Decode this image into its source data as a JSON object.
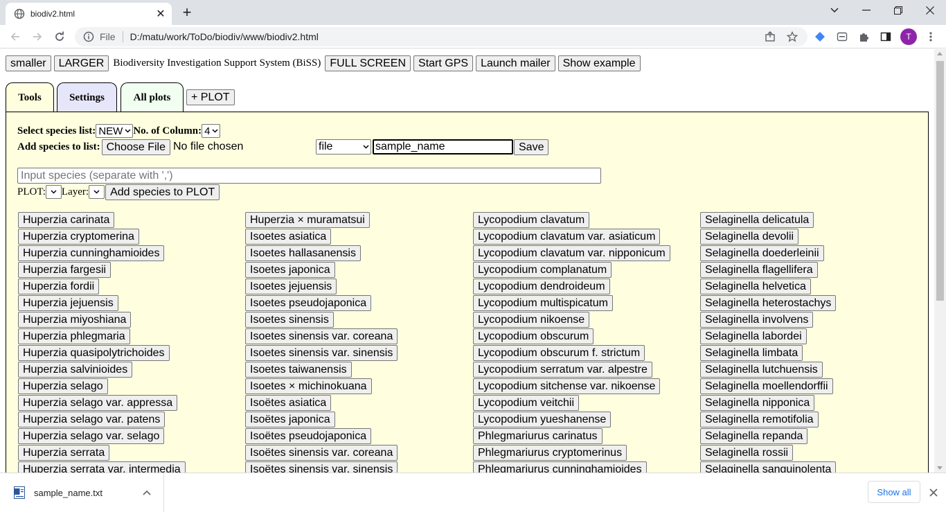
{
  "browser": {
    "tab_title": "biodiv2.html",
    "new_tab": "+",
    "scheme": "File",
    "url": "D:/matu/work/ToDo/biodiv/www/biodiv2.html",
    "avatar_letter": "T",
    "tab_close": "✕"
  },
  "topbar": {
    "smaller": "smaller",
    "larger": "LARGER",
    "title": "Biodiversity Investigation Support System (BiSS)",
    "fullscreen": "FULL SCREEN",
    "gps": "Start GPS",
    "mailer": "Launch mailer",
    "example": "Show example"
  },
  "tabs": {
    "tools": "Tools",
    "settings": "Settings",
    "allplots": "All plots",
    "addplot": "+ PLOT"
  },
  "tools": {
    "select_list_label": "Select species list:",
    "list_value": "NEW",
    "columns_label": "No. of Column:",
    "columns_value": "4",
    "add_label": "Add species to list:",
    "choose_file": "Choose File",
    "no_file": "No file chosen",
    "format_value": "file",
    "filename_value": "sample_name",
    "save": "Save",
    "species_placeholder": "Input species (separate with ',')",
    "plot_label": "PLOT:",
    "layer_label": "Layer:",
    "add_to_plot": "Add species to PLOT"
  },
  "species_columns": [
    [
      "Huperzia carinata",
      "Huperzia cryptomerina",
      "Huperzia cunninghamioides",
      "Huperzia fargesii",
      "Huperzia fordii",
      "Huperzia jejuensis",
      "Huperzia miyoshiana",
      "Huperzia phlegmaria",
      "Huperzia quasipolytrichoides",
      "Huperzia salvinioides",
      "Huperzia selago",
      "Huperzia selago var. appressa",
      "Huperzia selago var. patens",
      "Huperzia selago var. selago",
      "Huperzia serrata",
      "Huperzia serrata var. intermedia"
    ],
    [
      "Huperzia × muramatsui",
      "Isoetes asiatica",
      "Isoetes hallasanensis",
      "Isoetes japonica",
      "Isoetes jejuensis",
      "Isoetes pseudojaponica",
      "Isoetes sinensis",
      "Isoetes sinensis var. coreana",
      "Isoetes sinensis var. sinensis",
      "Isoetes taiwanensis",
      "Isoetes × michinokuana",
      "Isoëtes asiatica",
      "Isoëtes japonica",
      "Isoëtes pseudojaponica",
      "Isoëtes sinensis var. coreana",
      "Isoëtes sinensis var. sinensis"
    ],
    [
      "Lycopodium clavatum",
      "Lycopodium clavatum var. asiaticum",
      "Lycopodium clavatum var. nipponicum",
      "Lycopodium complanatum",
      "Lycopodium dendroideum",
      "Lycopodium multispicatum",
      "Lycopodium nikoense",
      "Lycopodium obscurum",
      "Lycopodium obscurum f. strictum",
      "Lycopodium serratum var. alpestre",
      "Lycopodium sitchense var. nikoense",
      "Lycopodium veitchii",
      "Lycopodium yueshanense",
      "Phlegmariurus carinatus",
      "Phlegmariurus cryptomerinus",
      "Phlegmariurus cunninghamioides"
    ],
    [
      "Selaginella delicatula",
      "Selaginella devolii",
      "Selaginella doederleinii",
      "Selaginella flagellifera",
      "Selaginella helvetica",
      "Selaginella heterostachys",
      "Selaginella involvens",
      "Selaginella labordei",
      "Selaginella limbata",
      "Selaginella lutchuensis",
      "Selaginella moellendorffii",
      "Selaginella nipponica",
      "Selaginella remotifolia",
      "Selaginella repanda",
      "Selaginella rossii",
      "Selaginella sanguinolenta"
    ]
  ],
  "downloads": {
    "file_name": "sample_name.txt",
    "show_all": "Show all"
  },
  "colors": {
    "panel_bg": "#ffffe0",
    "tab_tools_bg": "#ffffe0",
    "tab_settings_bg": "#e6e6fa",
    "tab_allplots_bg": "#f0fff0",
    "button_bg": "#efefef",
    "avatar": "#8e24aa",
    "link_blue": "#1a73e8"
  }
}
